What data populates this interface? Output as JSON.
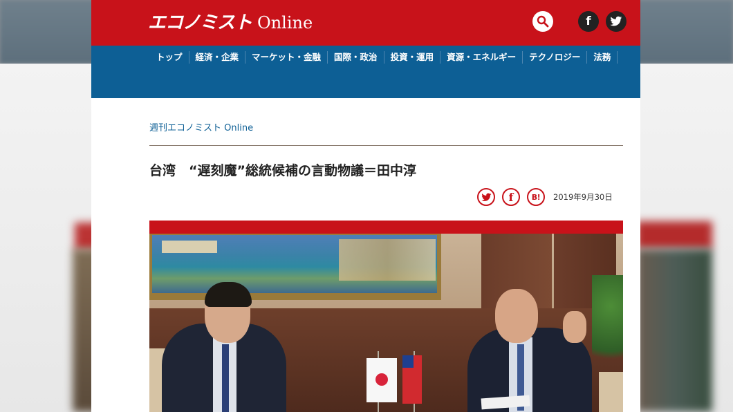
{
  "header": {
    "logo_ja": "エコノミスト",
    "logo_en": "Online",
    "icons": {
      "search": "search-icon",
      "facebook": "facebook-icon",
      "twitter": "twitter-icon"
    }
  },
  "nav": {
    "items": [
      "トップ",
      "経済・企業",
      "マーケット・金融",
      "国際・政治",
      "投資・運用",
      "資源・エネルギー",
      "テクノロジー",
      "法務"
    ]
  },
  "article": {
    "breadcrumb": "週刊エコノミスト Online",
    "title": "台湾　“遅刻魔”総統候補の言動物議＝田中淳",
    "share": {
      "twitter": "twitter-icon",
      "facebook": "f",
      "hatena": "B!"
    },
    "date": "2019年9月30日"
  },
  "colors": {
    "brand_red": "#c8121a",
    "nav_blue": "#0d5f95"
  }
}
